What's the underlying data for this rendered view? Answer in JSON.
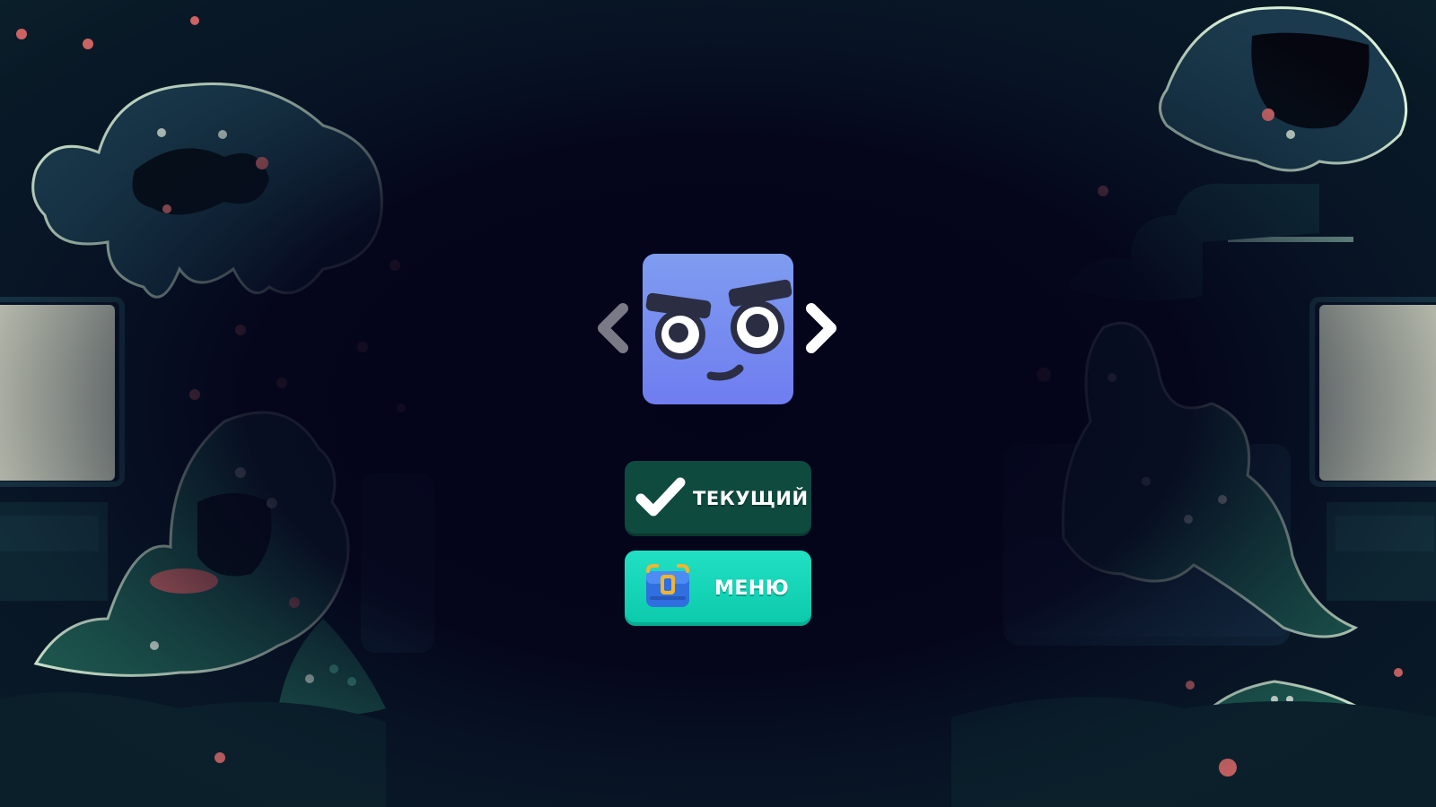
{
  "selector": {
    "prev_icon": "chevron-left-icon",
    "next_icon": "chevron-right-icon"
  },
  "character": {
    "icon": "blue-cube-face",
    "color": "#7b8cf0"
  },
  "buttons": {
    "current_label": "ТЕКУЩИЙ",
    "current_icon": "checkmark-icon",
    "current_color": "#0f4a3f",
    "menu_label": "МЕНЮ",
    "menu_icon": "backpack-icon",
    "menu_color": "#13d6b8"
  }
}
